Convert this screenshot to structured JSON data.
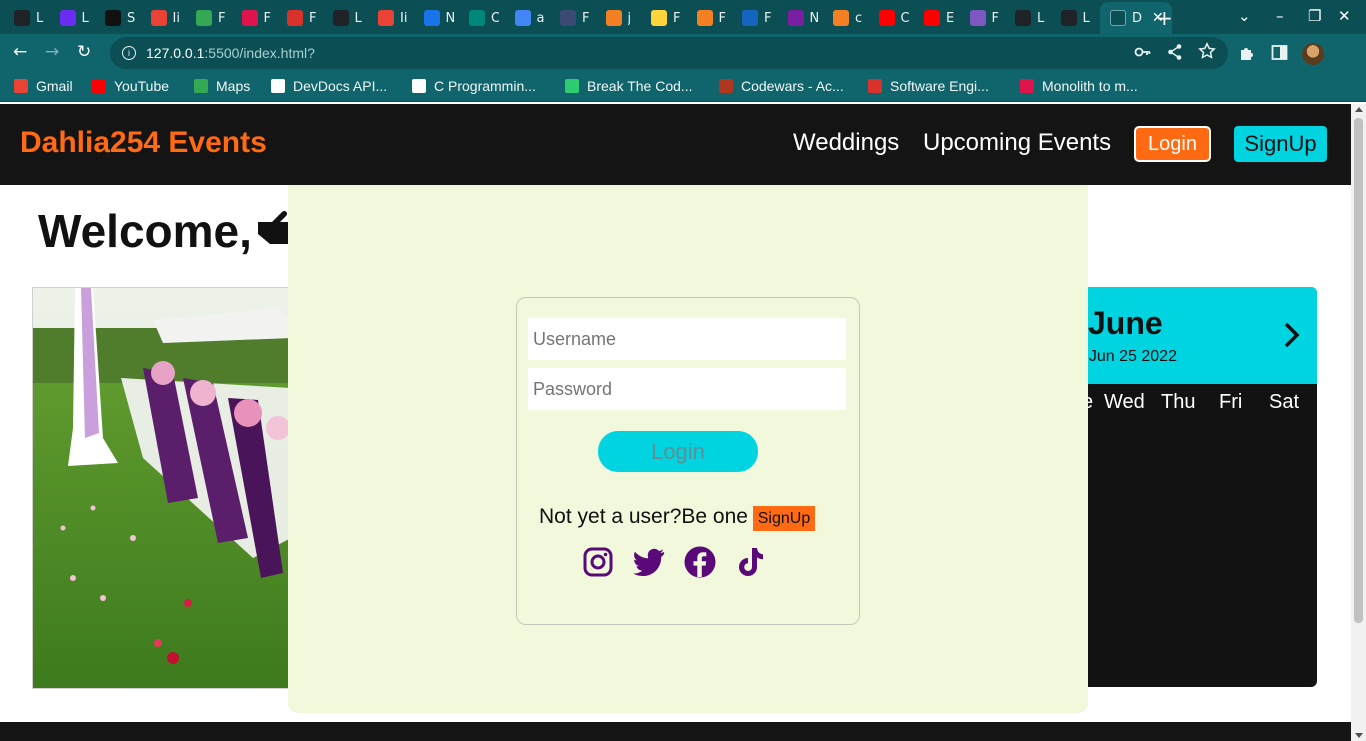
{
  "browser": {
    "tabs": [
      {
        "label": "L",
        "color": "#1f2328"
      },
      {
        "label": "L",
        "color": "#6a2cf0"
      },
      {
        "label": "S",
        "color": "#111111"
      },
      {
        "label": "Ii",
        "color": "#ea4335"
      },
      {
        "label": "F",
        "color": "#34a853"
      },
      {
        "label": "F",
        "color": "#e0144c"
      },
      {
        "label": "F",
        "color": "#d9322a"
      },
      {
        "label": "L",
        "color": "#1f2328"
      },
      {
        "label": "Ii",
        "color": "#ea4335"
      },
      {
        "label": "N",
        "color": "#1a73e8"
      },
      {
        "label": "C",
        "color": "#00897b"
      },
      {
        "label": "a",
        "color": "#4285f4"
      },
      {
        "label": "F",
        "color": "#3b4a73"
      },
      {
        "label": "j",
        "color": "#f48024"
      },
      {
        "label": "F",
        "color": "#ffd43b"
      },
      {
        "label": "F",
        "color": "#f48024"
      },
      {
        "label": "F",
        "color": "#1565c0"
      },
      {
        "label": "N",
        "color": "#7b1fa2"
      },
      {
        "label": "c",
        "color": "#f48024"
      },
      {
        "label": "C",
        "color": "#ff0000"
      },
      {
        "label": "E",
        "color": "#ff0000"
      },
      {
        "label": "F",
        "color": "#7e57c2"
      },
      {
        "label": "L",
        "color": "#1f2328"
      },
      {
        "label": "L",
        "color": "#1f2328"
      }
    ],
    "active_tab": {
      "label": "D",
      "close": "✕"
    },
    "new_tab": "+",
    "window_buttons": [
      "⌄",
      "–",
      "❐",
      "✕"
    ],
    "nav_buttons": [
      "←",
      "→",
      "↻"
    ],
    "url_host": "127.0.0.1",
    "url_path": ":5500/index.html?",
    "omnibox_icons": [
      "key-icon",
      "share-icon",
      "star-icon"
    ],
    "toolbar_icons": [
      "puzzle-icon",
      "sidepanel-icon",
      "avatar"
    ],
    "bookmarks": [
      {
        "label": "Gmail",
        "color": "#ea4335"
      },
      {
        "label": "YouTube",
        "color": "#ff0000"
      },
      {
        "label": "Maps",
        "color": "#34a853"
      },
      {
        "label": "DevDocs API...",
        "color": "#ffffff"
      },
      {
        "label": "C Programmin...",
        "color": "#ffffff"
      },
      {
        "label": "Break The Cod...",
        "color": "#2ecc71"
      },
      {
        "label": "Codewars - Ac...",
        "color": "#b1361e"
      },
      {
        "label": "Software Engi...",
        "color": "#d9322a"
      },
      {
        "label": "Monolith to m...",
        "color": "#e0144c"
      }
    ]
  },
  "site": {
    "brand": "Dahlia254 Events",
    "brand_color": "#ff6a13",
    "nav": [
      "Weddings",
      "Upcoming Events"
    ],
    "login_button": "Login",
    "signup_button": "SignUp",
    "welcome": "Welcome,",
    "accent": "#00d4e0",
    "calendar": {
      "month": "June",
      "date": "t Jun 25 2022",
      "days": [
        "e",
        "Wed",
        "Thu",
        "Fri",
        "Sat"
      ]
    }
  },
  "login_modal": {
    "username_placeholder": "Username",
    "password_placeholder": "Password",
    "login_button": "Login",
    "prompt": "Not yet a user?Be one",
    "signup_button": "SignUp",
    "social_icons": [
      "instagram-icon",
      "twitter-icon",
      "facebook-icon",
      "tiktok-icon"
    ],
    "icon_color": "#5a0a78",
    "background": "#f2f8dc"
  }
}
